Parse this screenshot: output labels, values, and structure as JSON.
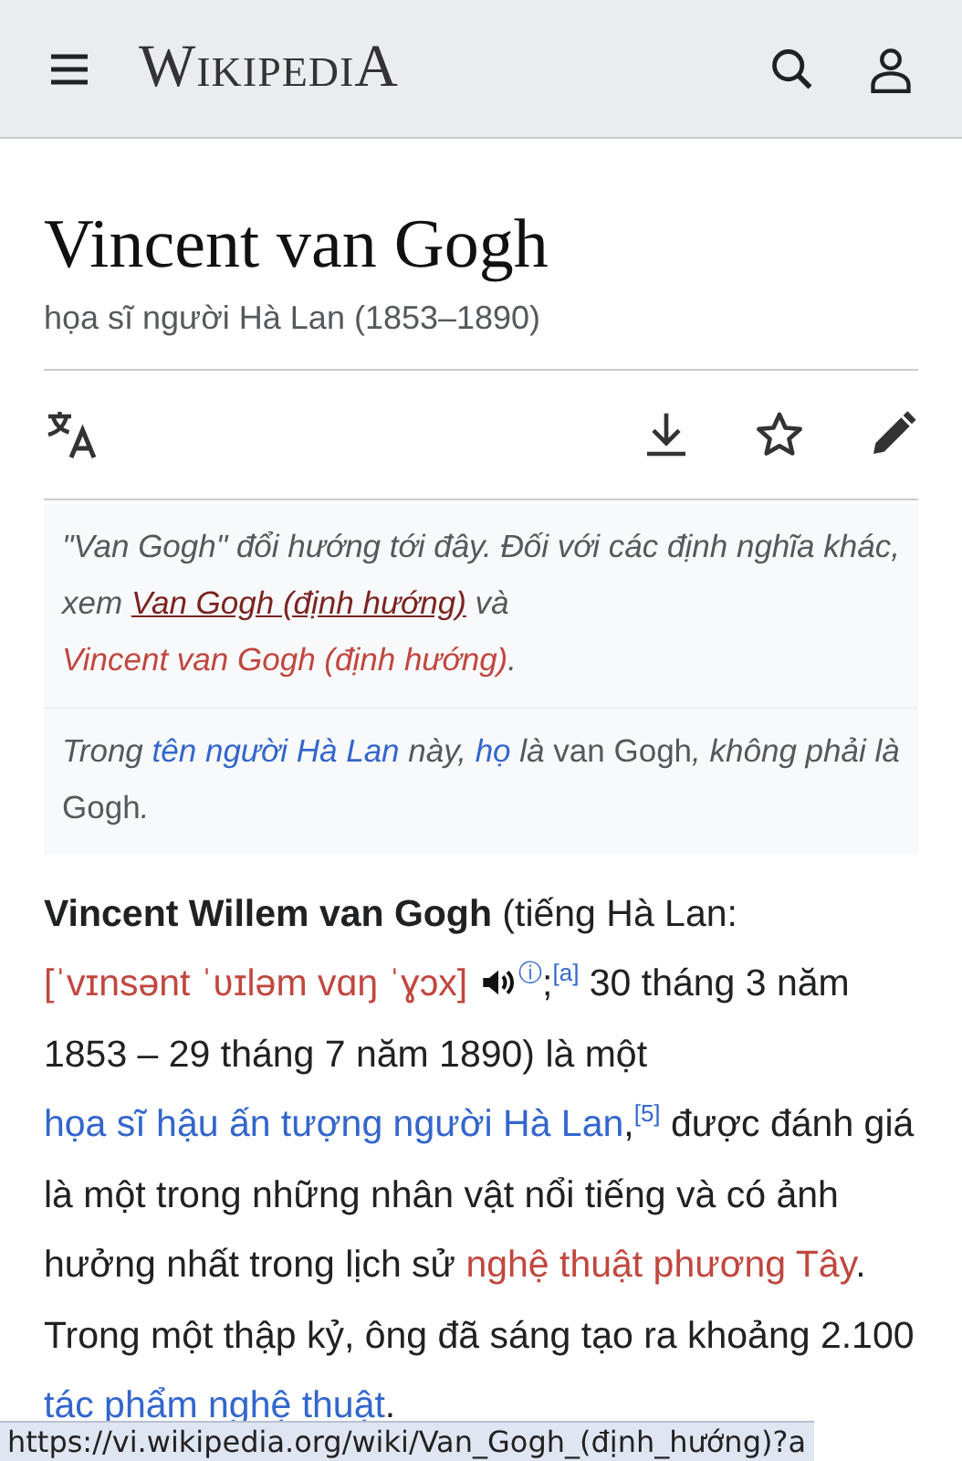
{
  "header": {
    "logo": "WikipediA"
  },
  "page": {
    "title": "Vincent van Gogh",
    "subtitle": "họa sĩ người Hà Lan (1853–1890)"
  },
  "hatnotes": [
    {
      "segments": [
        {
          "kind": "text",
          "text": "\"Van Gogh\" đổi hướng tới đây. Đối với các định nghĩa khác, xem "
        },
        {
          "kind": "visited",
          "text": "Van Gogh (định hướng)"
        },
        {
          "kind": "text",
          "text": " và "
        },
        {
          "kind": "redlink",
          "text": "Vincent van Gogh (định hướng)"
        },
        {
          "kind": "text",
          "text": "."
        }
      ]
    },
    {
      "segments": [
        {
          "kind": "text",
          "text": "Trong "
        },
        {
          "kind": "link",
          "text": "tên người Hà Lan"
        },
        {
          "kind": "text",
          "text": " này, "
        },
        {
          "kind": "link",
          "text": "họ"
        },
        {
          "kind": "text",
          "text": " là "
        },
        {
          "kind": "upright",
          "text": "van Gogh"
        },
        {
          "kind": "text",
          "text": ", không phải là "
        },
        {
          "kind": "upright",
          "text": "Gogh"
        },
        {
          "kind": "text",
          "text": "."
        }
      ]
    }
  ],
  "paragraph": {
    "segments": [
      {
        "kind": "bold",
        "text": "Vincent Willem van Gogh"
      },
      {
        "kind": "text",
        "text": " (tiếng Hà Lan: "
      },
      {
        "kind": "ipa",
        "text": "[ˈvɪnsənt ˈʋɪləm vɑŋ ˈɣɔx]"
      },
      {
        "kind": "audio"
      },
      {
        "kind": "sup",
        "text": "ⓘ"
      },
      {
        "kind": "text",
        "text": ";"
      },
      {
        "kind": "sup",
        "text": "[a]"
      },
      {
        "kind": "text",
        "text": " 30 tháng 3 năm 1853 – 29 tháng 7 năm 1890) là một "
      },
      {
        "kind": "link",
        "text": "họa sĩ hậu ấn tượng người Hà Lan"
      },
      {
        "kind": "text",
        "text": ","
      },
      {
        "kind": "sup",
        "text": "[5]"
      },
      {
        "kind": "text",
        "text": " được đánh giá là một trong những nhân vật nổi tiếng và có ảnh hưởng nhất trong lịch sử "
      },
      {
        "kind": "redlink",
        "text": "nghệ thuật phương Tây"
      },
      {
        "kind": "text",
        "text": ". Trong một thập kỷ, ông đã sáng tạo ra khoảng 2.100 "
      },
      {
        "kind": "link",
        "text": "tác phẩm nghệ thuật"
      },
      {
        "kind": "text",
        "text": "."
      }
    ]
  },
  "status_bar": {
    "url": "https://vi.wikipedia.org/wiki/Van_Gogh_(định_hướng)?a"
  }
}
